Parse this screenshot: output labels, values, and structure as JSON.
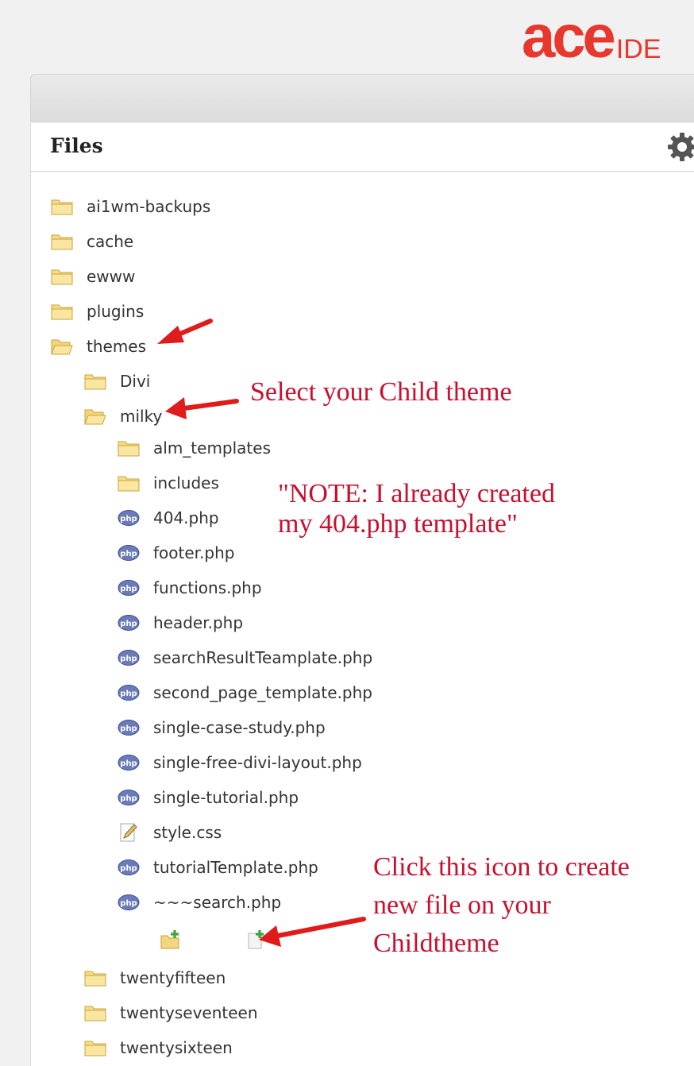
{
  "logo": {
    "main": "ace",
    "suffix": "IDE"
  },
  "panel": {
    "title": "Files"
  },
  "tree": {
    "root": [
      {
        "label": "ai1wm-backups"
      },
      {
        "label": "cache"
      },
      {
        "label": "ewww"
      },
      {
        "label": "plugins"
      },
      {
        "label": "themes"
      }
    ],
    "themes": [
      {
        "label": "Divi"
      },
      {
        "label": "milky"
      }
    ],
    "milky": [
      {
        "label": "alm_templates"
      },
      {
        "label": "includes"
      },
      {
        "label": "404.php"
      },
      {
        "label": "footer.php"
      },
      {
        "label": "functions.php"
      },
      {
        "label": "header.php"
      },
      {
        "label": "searchResultTeamplate.php"
      },
      {
        "label": "second_page_template.php"
      },
      {
        "label": "single-case-study.php"
      },
      {
        "label": "single-free-divi-layout.php"
      },
      {
        "label": "single-tutorial.php"
      },
      {
        "label": "style.css"
      },
      {
        "label": "tutorialTemplate.php"
      },
      {
        "label": "~~~search.php"
      }
    ],
    "themes_after": [
      {
        "label": "twentyfifteen"
      },
      {
        "label": "twentyseventeen"
      },
      {
        "label": "twentysixteen"
      }
    ]
  },
  "annotations": {
    "select_child": "Select your Child theme",
    "note_line1": "\"NOTE: I already created",
    "note_line2": "my 404.php template\"",
    "click_line1": "Click this icon to create",
    "click_line2": "new file on your",
    "click_line3": "Childtheme"
  },
  "icons": {
    "folder": "folder-icon",
    "folder_open": "folder-open-icon",
    "php": "php-file-icon",
    "css": "css-file-icon",
    "new_folder": "new-folder-icon",
    "new_file": "new-file-icon",
    "settings": "gear-icon"
  },
  "colors": {
    "accent": "#e8372c",
    "annotation": "#c8102e"
  }
}
